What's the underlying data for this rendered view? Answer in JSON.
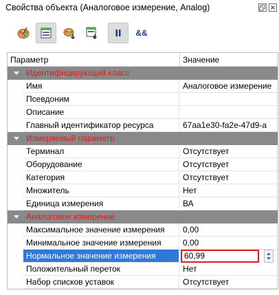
{
  "window": {
    "title": "Свойства объекта (Аналоговое измерение, Analog)"
  },
  "toolbar": {
    "buttons": [
      {
        "icon": "palette-icon",
        "active": false
      },
      {
        "icon": "window-grid-icon",
        "active": true
      },
      {
        "icon": "palette-down-icon",
        "active": false
      },
      {
        "icon": "window-down-icon",
        "active": false
      },
      {
        "icon": "pause-icon",
        "active": true
      },
      {
        "icon": "ampersand-icon",
        "text": "&&",
        "active": false
      }
    ]
  },
  "grid": {
    "headers": {
      "name": "Параметр",
      "value": "Значение"
    },
    "groups": [
      {
        "label": "Идентифицирующий класс",
        "rows": [
          {
            "name": "Имя",
            "value": "Аналоговое измерение"
          },
          {
            "name": "Псевдоним",
            "value": ""
          },
          {
            "name": "Описание",
            "value": ""
          },
          {
            "name": "Главный идентификатор ресурса",
            "value": "67aa1e30-fa2e-47d9-a"
          }
        ]
      },
      {
        "label": "Измеряемый параметр",
        "rows": [
          {
            "name": "Терминал",
            "value": "Отсутствует"
          },
          {
            "name": "Оборудование",
            "value": "Отсутствует"
          },
          {
            "name": "Категория",
            "value": "Отсутствует"
          },
          {
            "name": "Множитель",
            "value": "Нет"
          },
          {
            "name": "Единица измерения",
            "value": "ВА"
          }
        ]
      },
      {
        "label": "Аналоговое измерение",
        "rows": [
          {
            "name": "Максимальное значение измерения",
            "value": "0,00"
          },
          {
            "name": "Минимальное значение измерения",
            "value": "0,00"
          },
          {
            "name": "Нормальное значение измерения",
            "value": "60,99",
            "selected": true,
            "editing": true
          },
          {
            "name": "Положительный переток",
            "value": "Нет"
          },
          {
            "name": "Набор списков уставок",
            "value": "Отсутствует"
          }
        ]
      }
    ]
  },
  "colors": {
    "selection": "#3079d8",
    "group_bg": "#898989",
    "group_text": "#e31b1b",
    "editor_border": "#e01b24"
  }
}
